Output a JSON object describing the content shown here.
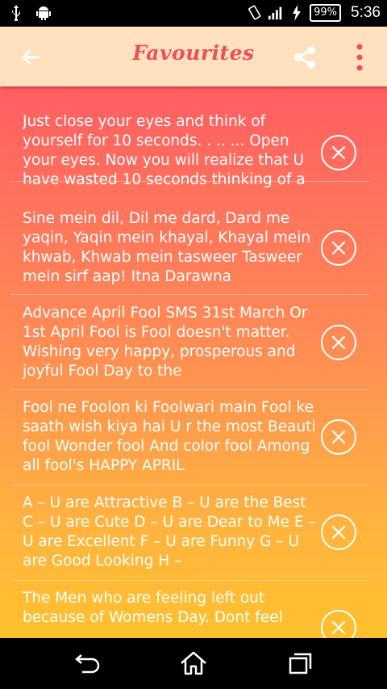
{
  "status_bar": {
    "battery": "99%",
    "time": "5:36"
  },
  "app_bar": {
    "title": "Favourites"
  },
  "favourites": [
    {
      "text": "Just close your eyes and think of yourself for 10 seconds. . .. ... Open your eyes. Now you will realize that U have wasted 10 seconds thinking of a"
    },
    {
      "text": "Sine mein dil, Dil me dard, Dard me yaqin, Yaqin mein khayal, Khayal mein khwab, Khwab mein tasweer Tasweer mein sirf aap! Itna Darawna"
    },
    {
      "text": "Advance April Fool SMS 31st March Or 1st April Fool is Fool doesn't matter. Wishing very happy, prosperous and joyful Fool Day to the"
    },
    {
      "text": "Fool ne Foolon ki Foolwari main Fool ke saath wish kiya hai U r the most Beauti fool Wonder fool And color fool Among all fool's HAPPY APRIL"
    },
    {
      "text": "A – U are Attractive B – U are the Best C – U are Cute D – U are Dear to Me E – U are Excellent F – U are Funny G – U are Good Looking H –"
    },
    {
      "text": "The Men who are feeling left out because of Womens Day. Dont feel"
    }
  ],
  "colors": {
    "app_bar_bg": "#FFE1BD",
    "title_color": "#EE4F5C",
    "gradient_top": "#FF5E63",
    "gradient_bottom": "#FFC12E"
  },
  "icons": {
    "back": "arrow-left-icon",
    "share": "share-icon",
    "more": "more-vertical-icon",
    "remove": "close-circle-icon"
  }
}
